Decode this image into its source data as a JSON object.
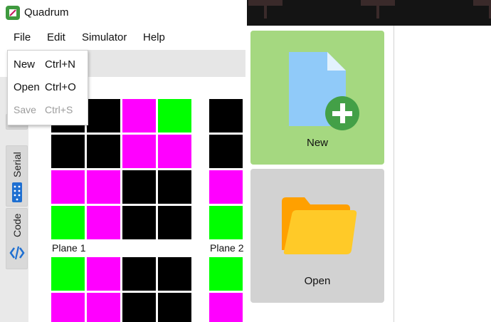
{
  "app": {
    "title": "Quadrum"
  },
  "menubar": {
    "file": "File",
    "edit": "Edit",
    "simulator": "Simulator",
    "help": "Help"
  },
  "file_menu": {
    "items": [
      {
        "label": "New",
        "shortcut": "Ctrl+N",
        "enabled": true
      },
      {
        "label": "Open",
        "shortcut": "Ctrl+O",
        "enabled": true
      },
      {
        "label": "Save",
        "shortcut": "Ctrl+S",
        "enabled": false
      }
    ]
  },
  "side_tabs": {
    "serial": "Serial",
    "code": "Code"
  },
  "planes": {
    "plane1_label": "Plane 1",
    "plane2_label": "Plane 2",
    "plane1_rows": [
      [
        "black",
        "black",
        "magenta",
        "green"
      ],
      [
        "black",
        "black",
        "magenta",
        "magenta"
      ],
      [
        "magenta",
        "magenta",
        "black",
        "black"
      ],
      [
        "green",
        "magenta",
        "black",
        "black"
      ]
    ],
    "plane2_rows_visible": [
      "black",
      "black",
      "magenta",
      "green"
    ],
    "bottom_rows": [
      [
        "green",
        "magenta",
        "black",
        "black"
      ],
      [
        "magenta",
        "magenta",
        "black",
        "black"
      ]
    ],
    "bottom_right_rows": [
      "green",
      "magenta"
    ]
  },
  "cards": {
    "new_label": "New",
    "open_label": "Open"
  },
  "colors": {
    "green": "#00ff00",
    "magenta": "#ff00ff",
    "black": "#000000",
    "card_new_bg": "#a5d880",
    "card_open_bg": "#d2d2d2",
    "app_icon": "#3f9a3f"
  },
  "icons": {
    "app": "quadrum-app-icon",
    "new": "new-file-icon",
    "open": "open-folder-icon",
    "serial": "serial-port-icon",
    "code": "code-brackets-icon"
  }
}
